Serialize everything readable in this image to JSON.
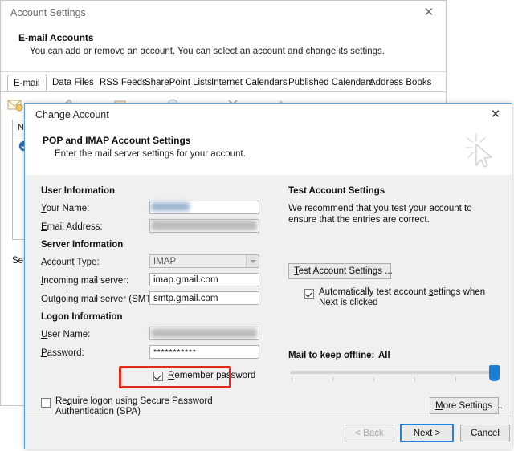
{
  "account_settings_window": {
    "title": "Account Settings",
    "close_icon": "close-icon",
    "header": {
      "title": "E-mail Accounts",
      "subtitle": "You can add or remove an account. You can select an account and change its settings."
    },
    "tabs": [
      {
        "label": "E-mail",
        "active": true
      },
      {
        "label": "Data Files",
        "active": false
      },
      {
        "label": "RSS Feeds",
        "active": false
      },
      {
        "label": "SharePoint Lists",
        "active": false
      },
      {
        "label": "Internet Calendars",
        "active": false
      },
      {
        "label": "Published Calendars",
        "active": false
      },
      {
        "label": "Address Books",
        "active": false
      }
    ],
    "list_header": "Na",
    "selected_label": "Sele"
  },
  "change_account_dialog": {
    "title": "Change Account",
    "close_icon": "close-icon",
    "header": {
      "title": "POP and IMAP Account Settings",
      "subtitle": "Enter the mail server settings for your account."
    },
    "user_information": {
      "group_title": "User Information",
      "your_name": {
        "label": "Your Name:",
        "value": "",
        "redacted": true
      },
      "email_address": {
        "label": "Email Address:",
        "value": "",
        "redacted": true
      }
    },
    "server_information": {
      "group_title": "Server Information",
      "account_type": {
        "label": "Account Type:",
        "value": "IMAP",
        "disabled": true
      },
      "incoming_mail_server": {
        "label": "Incoming mail server:",
        "value": "imap.gmail.com"
      },
      "outgoing_mail_server": {
        "label": "Outgoing mail server (SMTP):",
        "value": "smtp.gmail.com"
      }
    },
    "logon_information": {
      "group_title": "Logon Information",
      "user_name": {
        "label": "User Name:",
        "value": "",
        "redacted": true
      },
      "password": {
        "label": "Password:",
        "value": "***********"
      },
      "remember_password": {
        "label": "Remember password",
        "checked": true,
        "highlighted": true
      },
      "require_spa": {
        "label": "Require logon using Secure Password Authentication (SPA)",
        "checked": false
      }
    },
    "test_account_settings": {
      "group_title": "Test Account Settings",
      "description": "We recommend that you test your account to ensure that the entries are correct.",
      "button_label": "Test Account Settings ...",
      "auto_test": {
        "label": "Automatically test account settings when Next is clicked",
        "checked": true
      }
    },
    "mail_offline": {
      "label": "Mail to keep offline:",
      "value": "All",
      "slider_position_percent": 100,
      "tick_count": 5
    },
    "more_settings_button": "More Settings ...",
    "footer_buttons": {
      "back": {
        "label": "< Back",
        "disabled": true
      },
      "next": {
        "label": "Next >",
        "focused": true
      },
      "cancel": {
        "label": "Cancel",
        "disabled": false
      }
    }
  },
  "annotation": {
    "highlight_color": "#e02b20",
    "target": "remember-password-checkbox"
  }
}
